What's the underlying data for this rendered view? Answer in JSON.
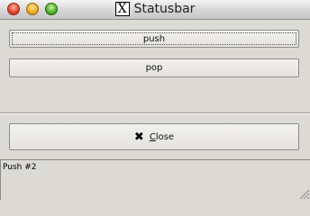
{
  "window": {
    "title": "Statusbar",
    "app_icon": "x11-icon",
    "controls": [
      "close",
      "minimize",
      "zoom"
    ]
  },
  "buttons": {
    "push_label": "push",
    "pop_label": "pop",
    "close_label_prefix": "C",
    "close_label_rest": "lose",
    "close_icon": "close-x-icon"
  },
  "statusbar": {
    "text": "Push #2"
  }
}
